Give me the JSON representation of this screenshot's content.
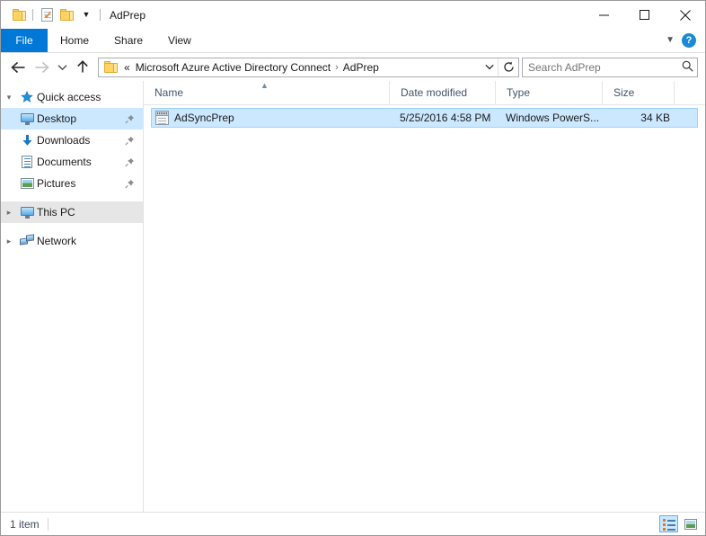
{
  "window": {
    "title": "AdPrep",
    "quick_access_toolbar": [
      {
        "icon": "folder-icon",
        "name": "properties-folder-icon"
      },
      {
        "icon": "properties-icon",
        "name": "properties-icon"
      },
      {
        "icon": "new-folder-icon",
        "name": "new-folder-icon"
      },
      {
        "icon": "chevron-down-icon",
        "name": "customize-qat-icon"
      }
    ],
    "controls": {
      "minimize": "Minimize",
      "maximize": "Maximize",
      "close": "Close"
    }
  },
  "ribbon": {
    "tabs": [
      {
        "label": "File",
        "active": true
      },
      {
        "label": "Home",
        "active": false
      },
      {
        "label": "Share",
        "active": false
      },
      {
        "label": "View",
        "active": false
      }
    ],
    "expand_icon": "chevron-down-icon",
    "help_label": "?"
  },
  "address_bar": {
    "back": "Back",
    "forward": "Forward",
    "recent": "Recent locations",
    "up": "Up",
    "breadcrumb_ellipsis": "«",
    "breadcrumbs": [
      {
        "label": "Microsoft Azure Active Directory Connect"
      },
      {
        "label": "AdPrep"
      }
    ],
    "separator": "›",
    "dropdown_icon": "chevron-down-icon",
    "refresh_icon": "refresh-icon"
  },
  "search": {
    "placeholder": "Search AdPrep",
    "value": "",
    "icon": "search-icon"
  },
  "sidebar": {
    "items": [
      {
        "label": "Quick access",
        "icon": "star-icon",
        "expander": "chevron-down-icon",
        "pinned": false,
        "state": "none"
      },
      {
        "label": "Desktop",
        "icon": "monitor-icon",
        "expander": "",
        "pinned": true,
        "state": "selected"
      },
      {
        "label": "Downloads",
        "icon": "download-arrow-icon",
        "expander": "",
        "pinned": true,
        "state": "none"
      },
      {
        "label": "Documents",
        "icon": "document-icon",
        "expander": "",
        "pinned": true,
        "state": "none"
      },
      {
        "label": "Pictures",
        "icon": "picture-icon",
        "expander": "",
        "pinned": true,
        "state": "none"
      },
      {
        "label": "This PC",
        "icon": "computer-icon",
        "expander": "chevron-right-icon",
        "pinned": false,
        "state": "highlighted"
      },
      {
        "label": "Network",
        "icon": "network-icon",
        "expander": "chevron-right-icon",
        "pinned": false,
        "state": "none"
      }
    ]
  },
  "file_list": {
    "columns": [
      {
        "label": "Name",
        "sorted": "ascending",
        "sort_icon": "chevron-up-icon"
      },
      {
        "label": "Date modified",
        "sorted": "",
        "sort_icon": ""
      },
      {
        "label": "Type",
        "sorted": "",
        "sort_icon": ""
      },
      {
        "label": "Size",
        "sorted": "",
        "sort_icon": ""
      }
    ],
    "rows": [
      {
        "name": "AdSyncPrep",
        "date_modified": "5/25/2016 4:58 PM",
        "type": "Windows PowerS...",
        "size": "34 KB",
        "icon": "powershell-script-icon",
        "selected": true
      }
    ]
  },
  "status_bar": {
    "item_count": "1 item",
    "views": [
      {
        "name": "details-view",
        "icon": "details-view-icon",
        "active": true
      },
      {
        "name": "large-icons-view",
        "icon": "large-icons-view-icon",
        "active": false
      }
    ]
  },
  "colors": {
    "accent": "#0078d7",
    "selection_fill": "#cce8ff",
    "selection_border": "#99d1ff",
    "header_text": "#44546a",
    "folder_yellow": "#ffd464"
  }
}
